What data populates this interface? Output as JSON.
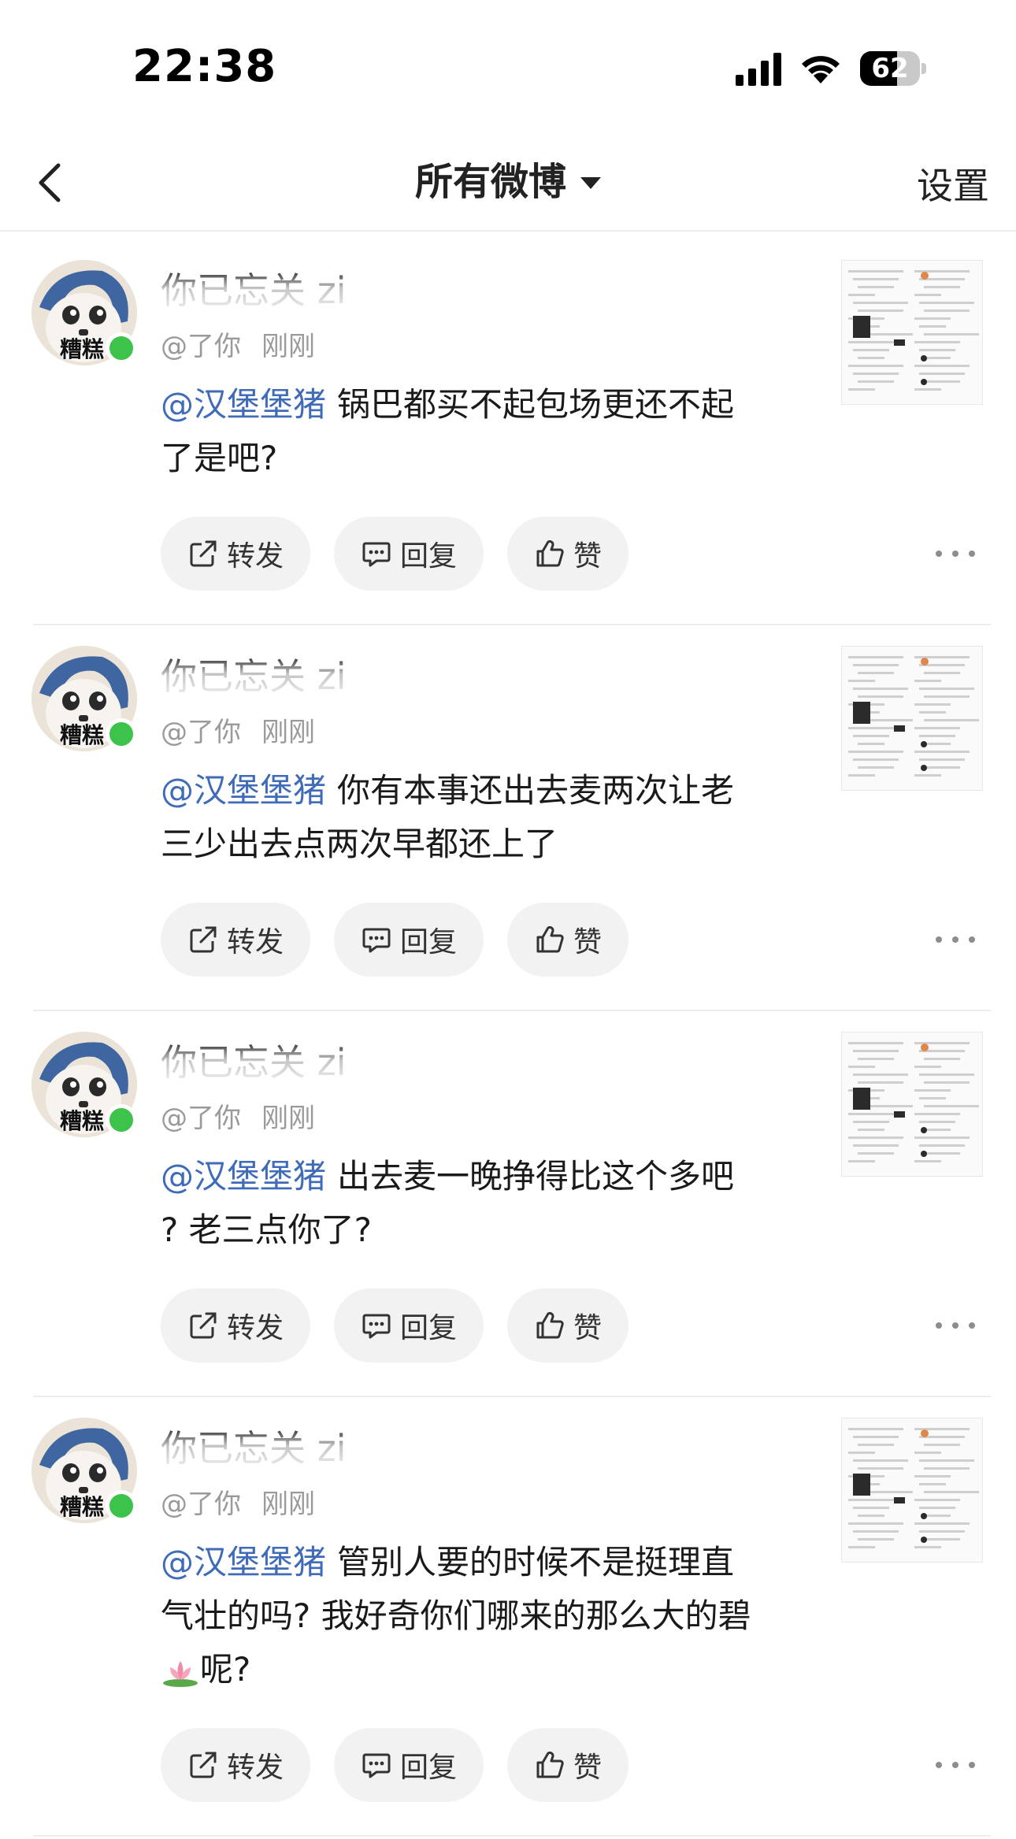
{
  "status_bar": {
    "time": "22:38",
    "battery": "62",
    "battery_level": 0.62,
    "icons": [
      "cellular-signal-icon",
      "wifi-icon",
      "battery-icon"
    ]
  },
  "nav": {
    "back_icon": "chevron-left-icon",
    "title": "所有微博",
    "title_icon": "caret-down-icon",
    "settings": "设置"
  },
  "feed": [
    {
      "username": "你已忘关 zi",
      "handle": "@了你",
      "time": "刚刚",
      "mention": "@汉堡堡猪",
      "text_lines": [
        "锅巴都买不起包场更还不起",
        "了是吧?"
      ],
      "actions": {
        "repost": "转发",
        "reply": "回复",
        "like": "赞"
      }
    },
    {
      "username": "你已忘关 zi",
      "handle": "@了你",
      "time": "刚刚",
      "mention": "@汉堡堡猪",
      "text_lines": [
        "你有本事还出去麦两次让老",
        "三少出去点两次早都还上了"
      ],
      "actions": {
        "repost": "转发",
        "reply": "回复",
        "like": "赞"
      }
    },
    {
      "username": "你已忘关 zi",
      "handle": "@了你",
      "time": "刚刚",
      "mention": "@汉堡堡猪",
      "text_lines": [
        "出去麦一晚挣得比这个多吧",
        "? 老三点你了?"
      ],
      "actions": {
        "repost": "转发",
        "reply": "回复",
        "like": "赞"
      }
    },
    {
      "username": "你已忘关 zi",
      "handle": "@了你",
      "time": "刚刚",
      "mention": "@汉堡堡猪",
      "text_lines": [
        "管别人要的时候不是挺理直",
        "气壮的吗? 我好奇你们哪来的那么大的碧",
        "呢?"
      ],
      "emoji": "lotus-icon",
      "actions": {
        "repost": "转发",
        "reply": "回复",
        "like": "赞"
      }
    }
  ],
  "avatar_label": "糟糕",
  "colors": {
    "mention": "#3f6bb8",
    "online": "#3bc34a",
    "button_bg": "#f2f2f2",
    "meta": "#9a9a9a"
  }
}
